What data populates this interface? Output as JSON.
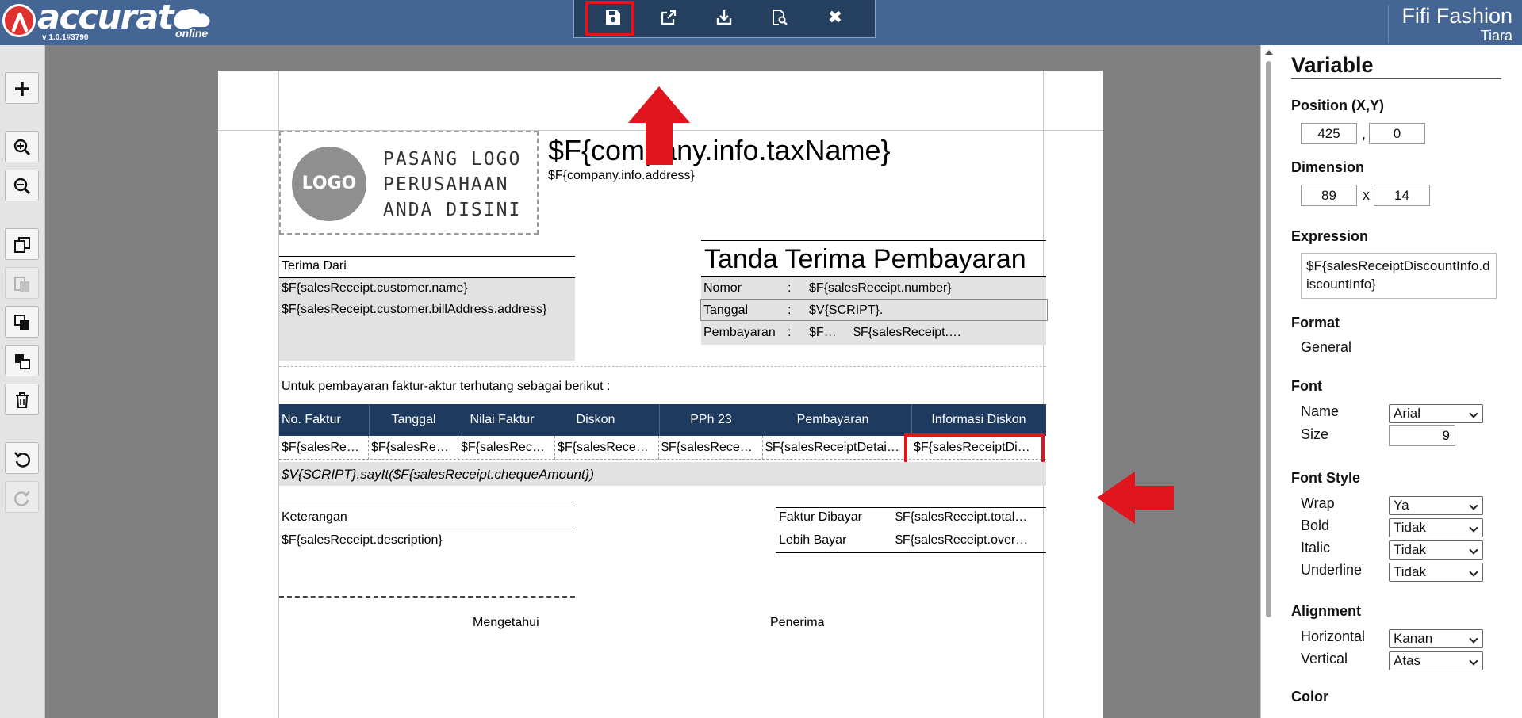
{
  "app": {
    "brand": "accurate",
    "brand_sub": "online",
    "version": "v 1.0.1#3790",
    "company_name": "Fifi Fashion",
    "user_name": "Tiara"
  },
  "toolbar": {
    "buttons": [
      {
        "name": "save",
        "icon": "save-icon"
      },
      {
        "name": "export",
        "icon": "export-icon"
      },
      {
        "name": "import",
        "icon": "import-icon"
      },
      {
        "name": "preview",
        "icon": "preview-icon"
      },
      {
        "name": "close",
        "icon": "close-icon",
        "glyph": "✖"
      }
    ]
  },
  "left_toolbar": {
    "buttons": [
      "add-icon",
      "zoom-in-icon",
      "zoom-out-icon",
      "copy-icon",
      "paste-icon",
      "bring-front-icon",
      "send-back-icon",
      "delete-icon",
      "undo-icon",
      "redo-icon"
    ]
  },
  "design": {
    "logo_label": "LOGO",
    "logo_text": "PASANG LOGO\nPERUSAHAAN\nANDA DISINI",
    "company_tax_name": "$F{company.info.taxName}",
    "company_address": "$F{company.info.address}",
    "receive_from_label": "Terima Dari",
    "customer_name": "$F{salesReceipt.customer.name}",
    "customer_address": "$F{salesReceipt.customer.billAddress.address}",
    "doc_title": "Tanda Terima Pembayaran",
    "info_rows": [
      {
        "label": "Nomor",
        "colon": ":",
        "value": "$F{salesReceipt.number}"
      },
      {
        "label": "Tanggal",
        "colon": ":",
        "value": "$V{SCRIPT}."
      },
      {
        "label": "Pembayaran",
        "colon": ":",
        "value": "$F…",
        "value2": "$F{salesReceipt.…"
      }
    ],
    "intro_text": "Untuk pembayaran faktur-aktur terhutang sebagai berikut :",
    "table_headers": [
      "No. Faktur",
      "Tanggal",
      "Nilai Faktur",
      "Diskon",
      "PPh 23",
      "Pembayaran",
      "Informasi Diskon"
    ],
    "table_row": [
      "$F{salesRe…",
      "$F{salesRe…",
      "$F{salesRec…",
      "$F{salesRece…",
      "$F{salesRece…",
      "$F{salesReceiptDetai…",
      "$F{salesReceiptDi…"
    ],
    "say_it": "$V{SCRIPT}.sayIt($F{salesReceipt.chequeAmount})",
    "notes_label": "Keterangan",
    "notes_value": "$F{salesReceipt.description}",
    "totals": [
      {
        "label": "Faktur Dibayar",
        "value": "$F{salesReceipt.total…"
      },
      {
        "label": "Lebih Bayar",
        "value": "$F{salesReceipt.over…"
      }
    ],
    "sign_left": "Mengetahui",
    "sign_right": "Penerima"
  },
  "properties": {
    "title": "Variable",
    "position_label": "Position (X,Y)",
    "pos_x": "425",
    "pos_sep": ",",
    "pos_y": "0",
    "dimension_label": "Dimension",
    "dim_w": "89",
    "dim_sep": "x",
    "dim_h": "14",
    "expression_label": "Expression",
    "expression": "$F{salesReceiptDiscountInfo.discountInfo}",
    "format_label": "Format",
    "format_value": "General",
    "font_label": "Font",
    "font_name_label": "Name",
    "font_name": "Arial",
    "font_size_label": "Size",
    "font_size": "9",
    "font_style_label": "Font Style",
    "wrap_label": "Wrap",
    "wrap": "Ya",
    "bold_label": "Bold",
    "bold": "Tidak",
    "italic_label": "Italic",
    "italic": "Tidak",
    "underline_label": "Underline",
    "underline": "Tidak",
    "alignment_label": "Alignment",
    "horizontal_label": "Horizontal",
    "horizontal": "Kanan",
    "vertical_label": "Vertical",
    "vertical": "Atas",
    "color_label": "Color"
  },
  "colors": {
    "topbar": "#456594",
    "header_fill": "#1e3a5f",
    "highlight": "#e0151e"
  }
}
